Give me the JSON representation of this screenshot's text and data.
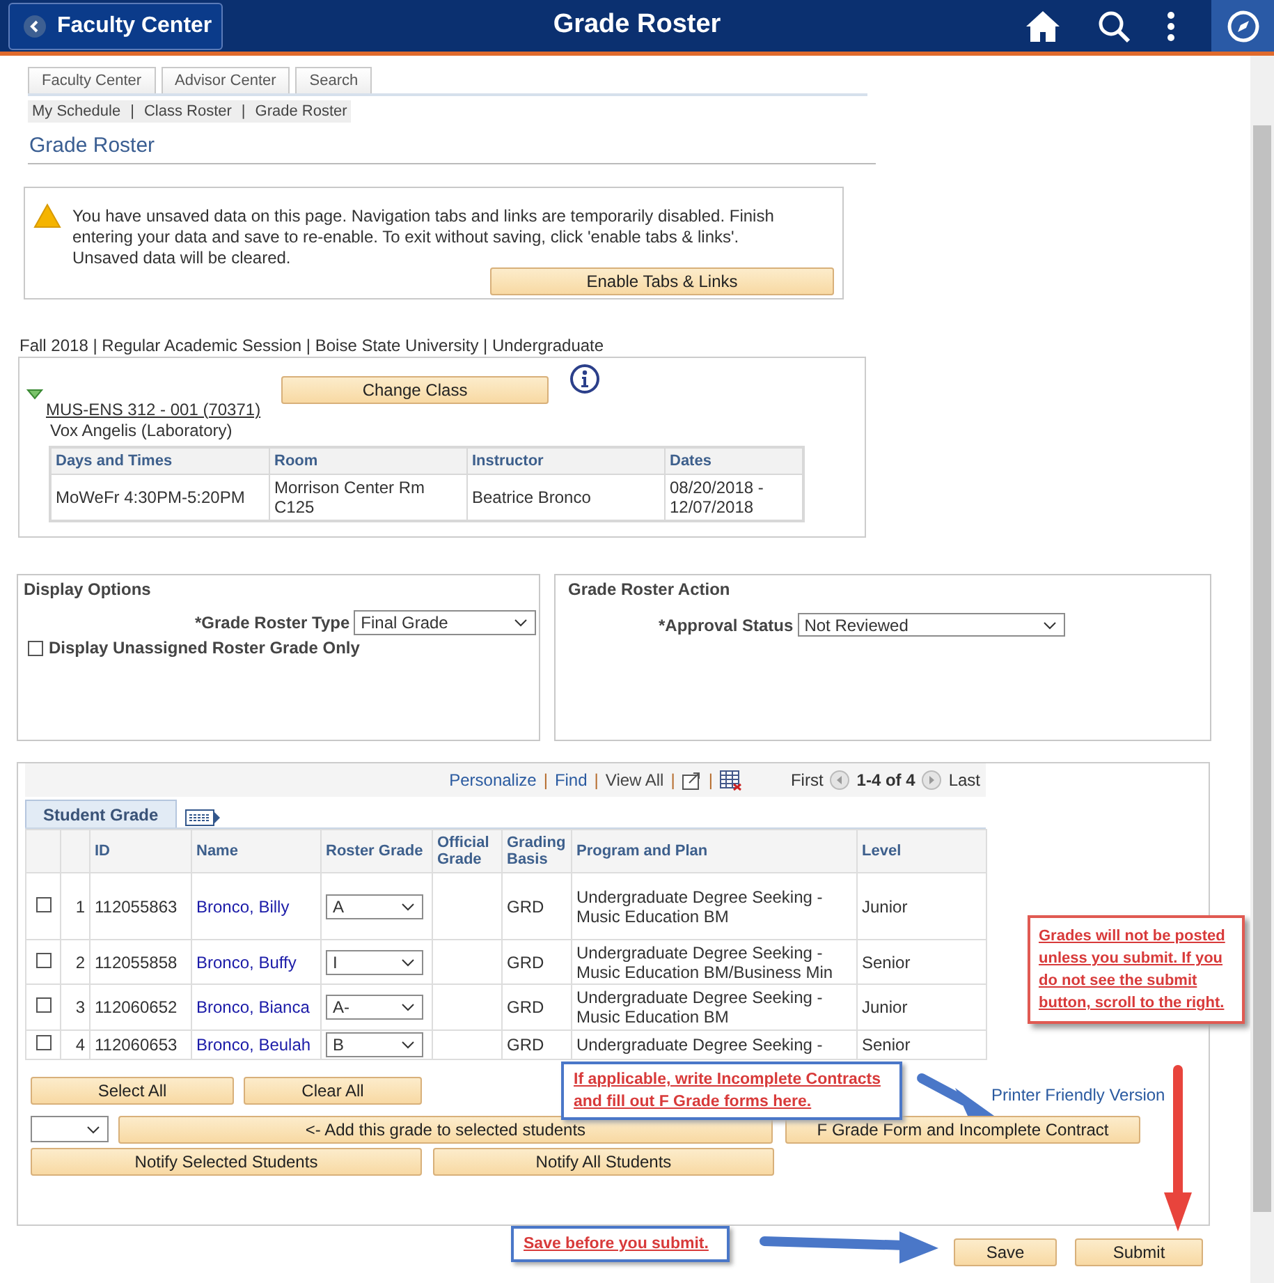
{
  "header": {
    "back_label": "Faculty Center",
    "title": "Grade Roster"
  },
  "tabs": [
    "Faculty Center",
    "Advisor Center",
    "Search"
  ],
  "breadcrumbs": [
    "My Schedule",
    "Class Roster",
    "Grade Roster"
  ],
  "breadcrumb_separator": "|",
  "page_title": "Grade Roster",
  "warning": {
    "message": "You have unsaved data on this page. Navigation tabs and links are temporarily disabled. Finish entering your data and save to re-enable. To exit without saving, click 'enable tabs & links'. Unsaved data will be cleared.",
    "button": "Enable Tabs & Links"
  },
  "term": "Fall 2018 | Regular Academic Session | Boise State University | Undergraduate",
  "class": {
    "expanded": true,
    "course": "MUS-ENS 312 - 001 (70371)",
    "button": "Change Class",
    "description": "Vox Angelis (Laboratory)",
    "meeting_columns": [
      "Days and Times",
      "Room",
      "Instructor",
      "Dates"
    ],
    "meetings": [
      [
        "MoWeFr 4:30PM-5:20PM",
        "Morrison Center Rm C125",
        "Beatrice Bronco",
        "08/20/2018 - 12/07/2018"
      ]
    ]
  },
  "display_options": {
    "title": "Display Options",
    "grade_roster_type": {
      "label": "*Grade Roster Type",
      "value": "Final Grade"
    },
    "unassigned_only": {
      "label": "Display Unassigned Roster Grade Only",
      "checked": false
    }
  },
  "roster_action": {
    "title": "Grade Roster Action",
    "approval_status": {
      "label": "*Approval Status",
      "value": "Not Reviewed"
    }
  },
  "grid": {
    "links": [
      "Personalize",
      "Find",
      "View All"
    ],
    "link_separator": "|",
    "first": "First",
    "range": "1-4 of 4",
    "last": "Last",
    "tab": "Student Grade",
    "columns": [
      "ID",
      "Name",
      "Roster Grade",
      "Official Grade",
      "Grading Basis",
      "Program and Plan",
      "Level"
    ],
    "rows": [
      {
        "number": "1",
        "checked": false,
        "id": "112055863",
        "name": "Bronco, Billy",
        "roster_grade": "A",
        "grading_basis": "GRD",
        "program": "Undergraduate Degree Seeking - Music Education BM",
        "level": "Junior"
      },
      {
        "number": "2",
        "checked": false,
        "id": "112055858",
        "name": "Bronco, Buffy",
        "roster_grade": "I",
        "grading_basis": "GRD",
        "program": "Undergraduate Degree Seeking - Music Education BM/Business Min",
        "level": "Senior"
      },
      {
        "number": "3",
        "checked": false,
        "id": "112060652",
        "name": "Bronco, Bianca",
        "roster_grade": "A-",
        "grading_basis": "GRD",
        "program": "Undergraduate Degree Seeking - Music Education BM",
        "level": "Junior"
      },
      {
        "number": "4",
        "checked": false,
        "id": "112060653",
        "name": "Bronco, Beulah",
        "roster_grade": "B",
        "grading_basis": "GRD",
        "program": "Undergraduate Degree Seeking -",
        "level": "Senior"
      }
    ],
    "select_all": "Select All",
    "clear_all": "Clear All",
    "printer_link": "Printer Friendly Version",
    "add_grade_button": "<- Add this grade to selected students",
    "f_grade_button": "F Grade Form and Incomplete Contract",
    "notify_selected": "Notify Selected Students",
    "notify_all": "Notify All Students"
  },
  "actions": {
    "save": "Save",
    "submit": "Submit"
  },
  "annotations": [
    {
      "text": "Grades will not be posted unless you submit. If you do not see the submit button, scroll to the right."
    },
    {
      "text": "If applicable, write Incomplete Contracts and fill out F Grade forms here."
    },
    {
      "text": "Save before you submit."
    }
  ]
}
